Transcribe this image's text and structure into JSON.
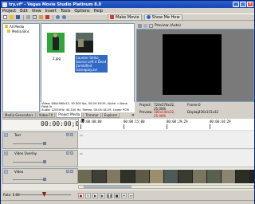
{
  "window": {
    "title": "try.vf* - Vegas Movie Studio Platinum 8.0",
    "controls": [
      "_",
      "□",
      "x"
    ]
  },
  "menu": [
    "Project",
    "Edit",
    "View",
    "Insert",
    "Tools",
    "Options",
    "Help"
  ],
  "toolbar": {
    "make_movie": "Make Movie",
    "show_me_how": "Show Me How"
  },
  "tree": {
    "items": [
      "All Media",
      "Media Bins"
    ]
  },
  "media": {
    "files": [
      {
        "label": "2.jpg",
        "selected": false
      },
      {
        "label": "Counter Strike_ Source Left 4 Dead Zombified Gameplay.avi",
        "selected": true
      }
    ],
    "info_line1": "Video: 480x360x12, 30.000 fps, 00:04:18:29, Alpha = None, Field Or",
    "info_line2": "Audio: 22050Hz, 44,100 Hz, Stereo, 00:04:18:29, Linear PCM"
  },
  "tabs": [
    "Media Generators",
    "Video FX",
    "Project Media",
    "Trimmer",
    "Explorer"
  ],
  "active_tab": "Project Media",
  "preview": {
    "mode": "Preview (Auto)",
    "info": {
      "project_label": "Project:",
      "project_value": "720x576x32, 25.000i",
      "preview_label": "Preview:",
      "preview_value": "180x144x32, 25.000i",
      "frame_label": "Frame:",
      "frame_value": "0",
      "display_label": "Display:",
      "display_value": "236x151x32"
    }
  },
  "timeline": {
    "timecode": "00:00:00;00",
    "ruler_labels": [
      "00:00:00;00",
      "00:00:15;00",
      "00:00:29;29",
      "00:00:44;29"
    ]
  },
  "tracks": [
    {
      "number": "1",
      "name": "Text"
    },
    {
      "number": "2",
      "name": "Video Overlay"
    },
    {
      "number": "3",
      "name": "Video"
    }
  ],
  "bottom": {
    "rate_label": "Rate: 0.00"
  },
  "colors": {
    "title_bar": "#1447b4",
    "selection": "#316ac5",
    "green_screen": "#2fa63a"
  }
}
